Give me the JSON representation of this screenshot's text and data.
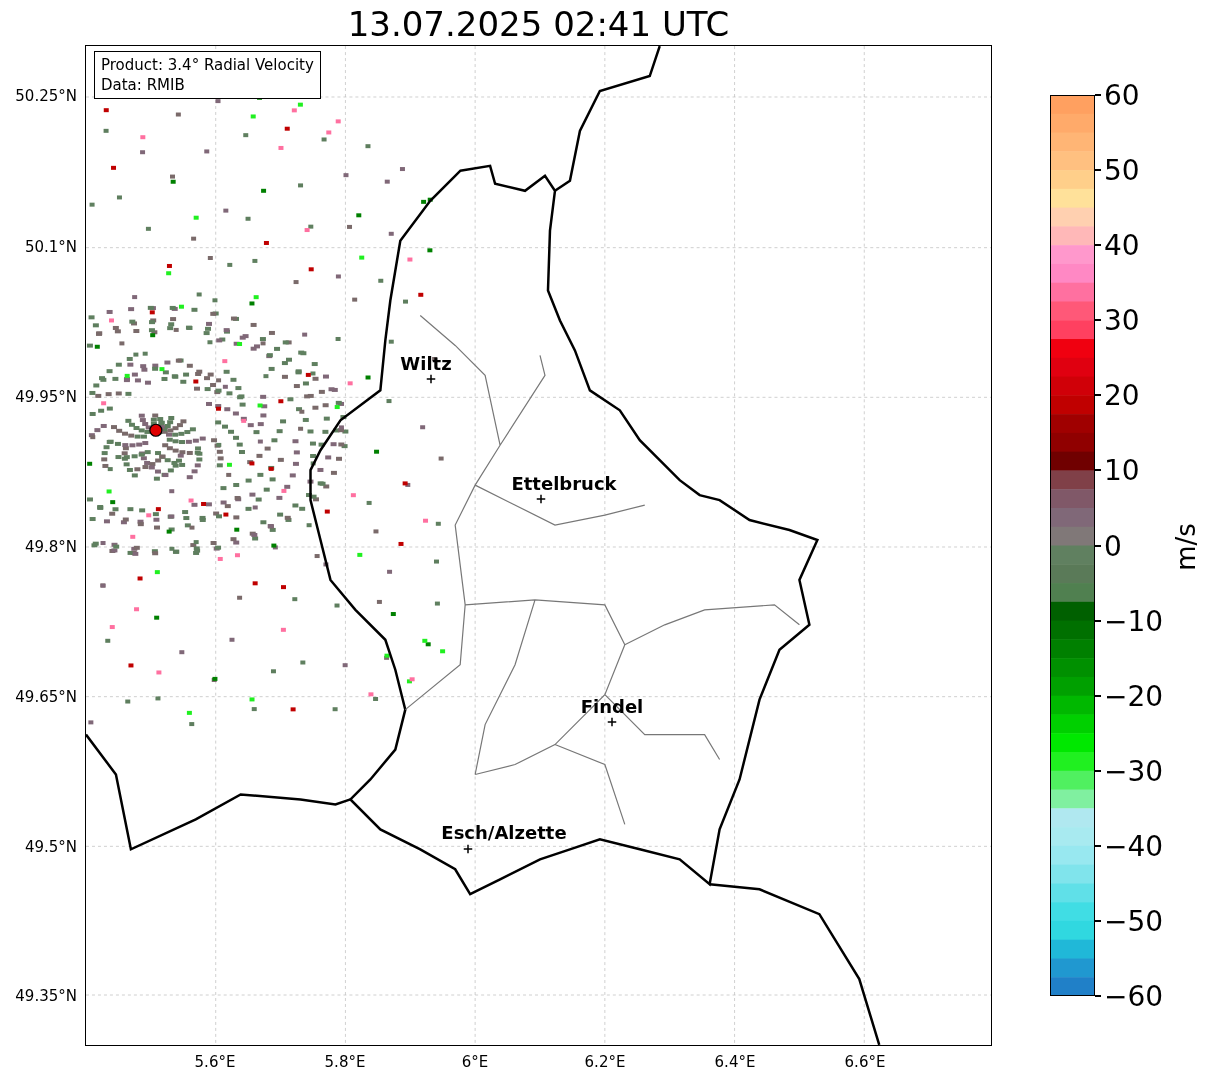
{
  "title": "13.07.2025 02:41 UTC",
  "info_box": {
    "lines": [
      "Product: 3.4° Radial Velocity",
      "Data: RMIB"
    ]
  },
  "y_ticks": [
    "50.25°N",
    "50.1°N",
    "49.95°N",
    "49.8°N",
    "49.65°N",
    "49.5°N",
    "49.35°N"
  ],
  "x_ticks": [
    "5.6°E",
    "5.8°E",
    "6°E",
    "6.2°E",
    "6.4°E",
    "6.6°E"
  ],
  "places": [
    {
      "name": "Wiltz"
    },
    {
      "name": "Ettelbruck"
    },
    {
      "name": "Findel"
    },
    {
      "name": "Esch/Alzette"
    }
  ],
  "colorbar": {
    "label": "m/s",
    "ticks": [
      "60",
      "50",
      "40",
      "30",
      "20",
      "10",
      "0",
      "−10",
      "−20",
      "−30",
      "−40",
      "−50",
      "−60"
    ]
  }
}
